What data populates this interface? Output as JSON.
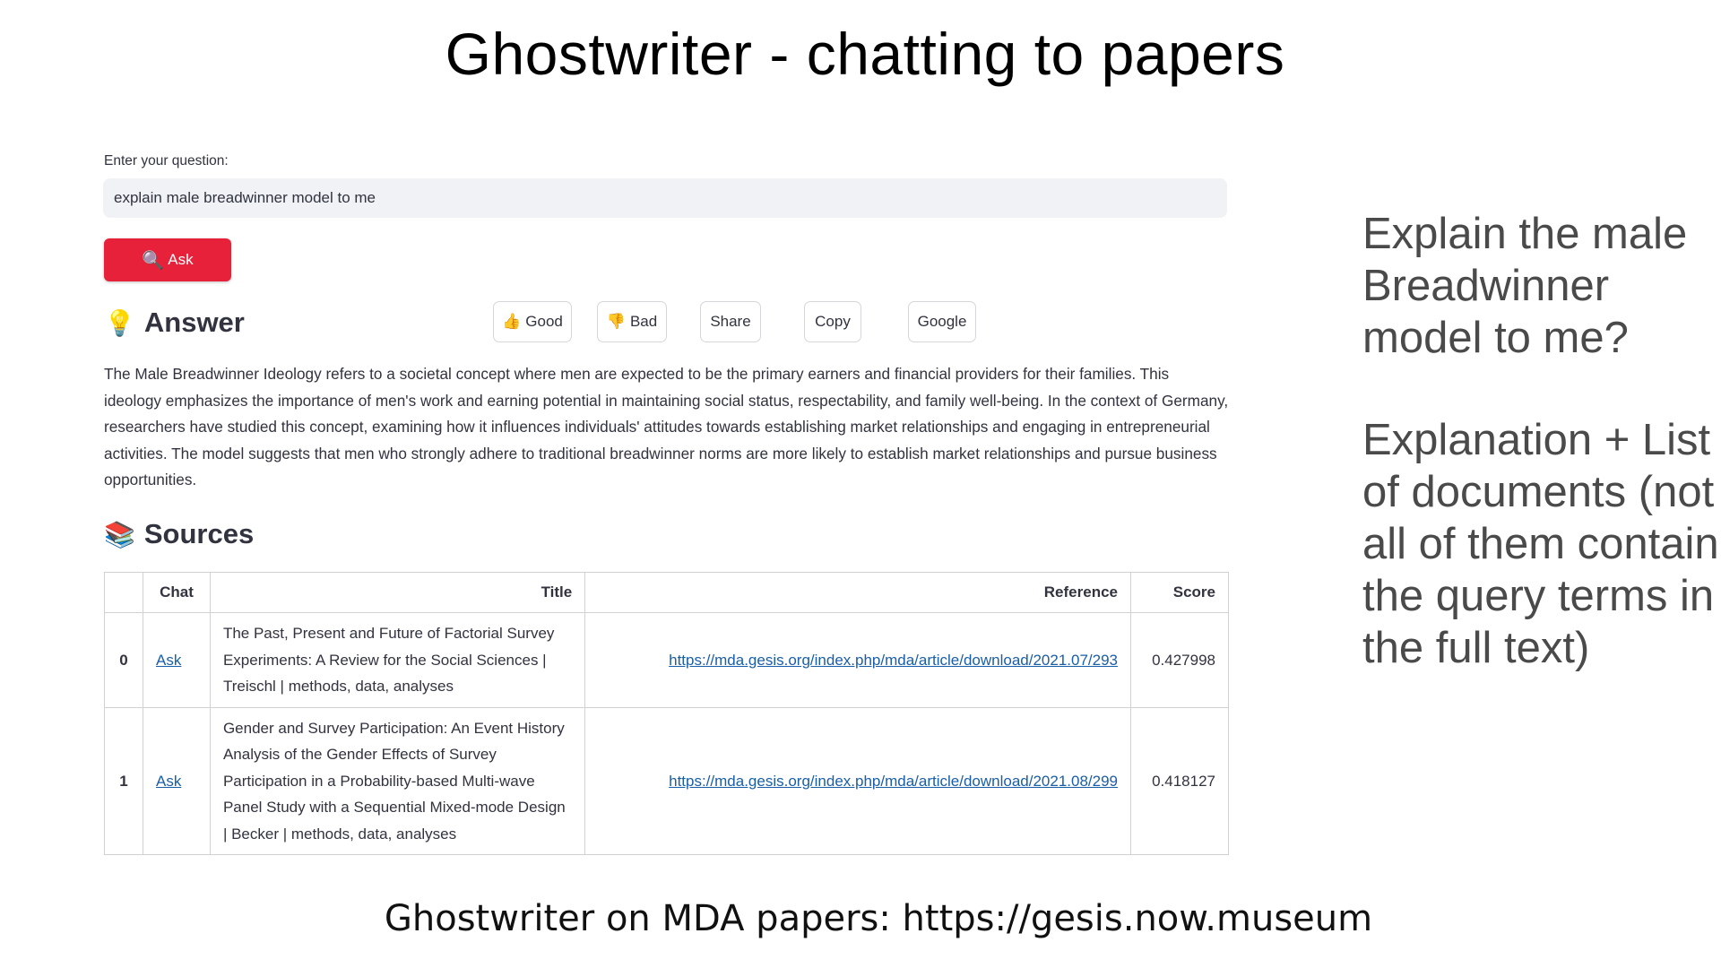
{
  "slide": {
    "title": "Ghostwriter - chatting to papers",
    "notes": [
      "Explain the male Breadwinner model to me?",
      "Explanation + List of documents (not all of them contain the query terms in the full text)"
    ],
    "footer": "Ghostwriter on MDA papers: https://gesis.now.museum"
  },
  "app": {
    "question_label": "Enter your question:",
    "question_value": "explain male breadwinner model to me",
    "ask_label": "Ask",
    "answer_heading": "Answer",
    "feedback": {
      "good": "Good",
      "bad": "Bad",
      "share": "Share",
      "copy": "Copy",
      "google": "Google"
    },
    "answer_text": "The Male Breadwinner Ideology refers to a societal concept where men are expected to be the primary earners and financial providers for their families. This ideology emphasizes the importance of men's work and earning potential in maintaining social status, respectability, and family well-being. In the context of Germany, researchers have studied this concept, examining how it influences individuals' attitudes towards establishing market relationships and engaging in entrepreneurial activities. The model suggests that men who strongly adhere to traditional breadwinner norms are more likely to establish market relationships and pursue business opportunities.",
    "sources_heading": "Sources",
    "table": {
      "headers": [
        "",
        "Chat",
        "Title",
        "Reference",
        "Score"
      ],
      "rows": [
        {
          "index": "0",
          "chat": "Ask",
          "title": "The Past, Present and Future of Factorial Survey Experiments: A Review for the Social Sciences | Treischl | methods, data, analyses",
          "reference": "https://mda.gesis.org/index.php/mda/article/download/2021.07/293",
          "score": "0.427998"
        },
        {
          "index": "1",
          "chat": "Ask",
          "title": "Gender and Survey Participation: An Event History Analysis of the Gender Effects of Survey Participation in a Probability-based Multi-wave Panel Study with a Sequential Mixed-mode Design | Becker | methods, data, analyses",
          "reference": "https://mda.gesis.org/index.php/mda/article/download/2021.08/299",
          "score": "0.418127"
        }
      ]
    }
  },
  "colors": {
    "ask_button": "#e8213a",
    "input_bg": "#f0f2f6",
    "link": "#1a5ea8",
    "notes_text": "#4a4a4a"
  },
  "icons": {
    "ask": "magnifier-icon",
    "answer": "lightbulb-icon",
    "sources": "books-icon",
    "good": "thumbs-up-icon",
    "bad": "thumbs-down-icon"
  }
}
